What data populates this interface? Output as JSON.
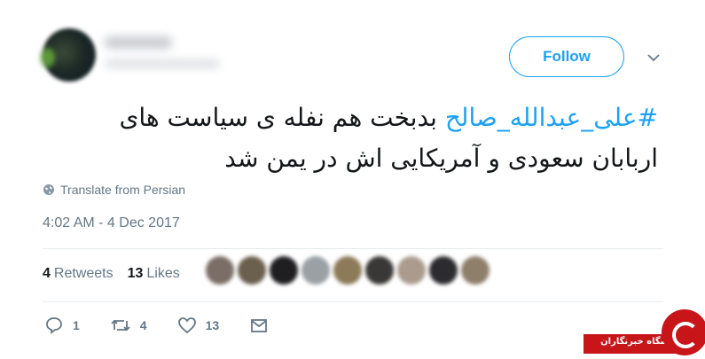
{
  "header": {
    "follow_label": "Follow"
  },
  "tweet": {
    "hashtag": "#علی_عبدالله_صالح",
    "text": " بدبخت هم نفله ی سیاست های اربابان سعودی و آمریکایی اش در یمن شد"
  },
  "translate": {
    "label": "Translate from Persian"
  },
  "timestamp": "4:02 AM - 4 Dec 2017",
  "stats": {
    "retweets_count": "4",
    "retweets_label": "Retweets",
    "likes_count": "13",
    "likes_label": "Likes"
  },
  "actions": {
    "reply_count": "1",
    "retweet_count": "4",
    "like_count": "13"
  },
  "watermark": {
    "text": "باشگاه خبرنگاران"
  },
  "colors": {
    "accent": "#1da1f2",
    "muted": "#657786",
    "text": "#14171a",
    "watermark": "#c7151a"
  },
  "icons": [
    "chevron-down-icon",
    "globe-icon",
    "reply-icon",
    "retweet-icon",
    "heart-icon",
    "message-icon"
  ]
}
